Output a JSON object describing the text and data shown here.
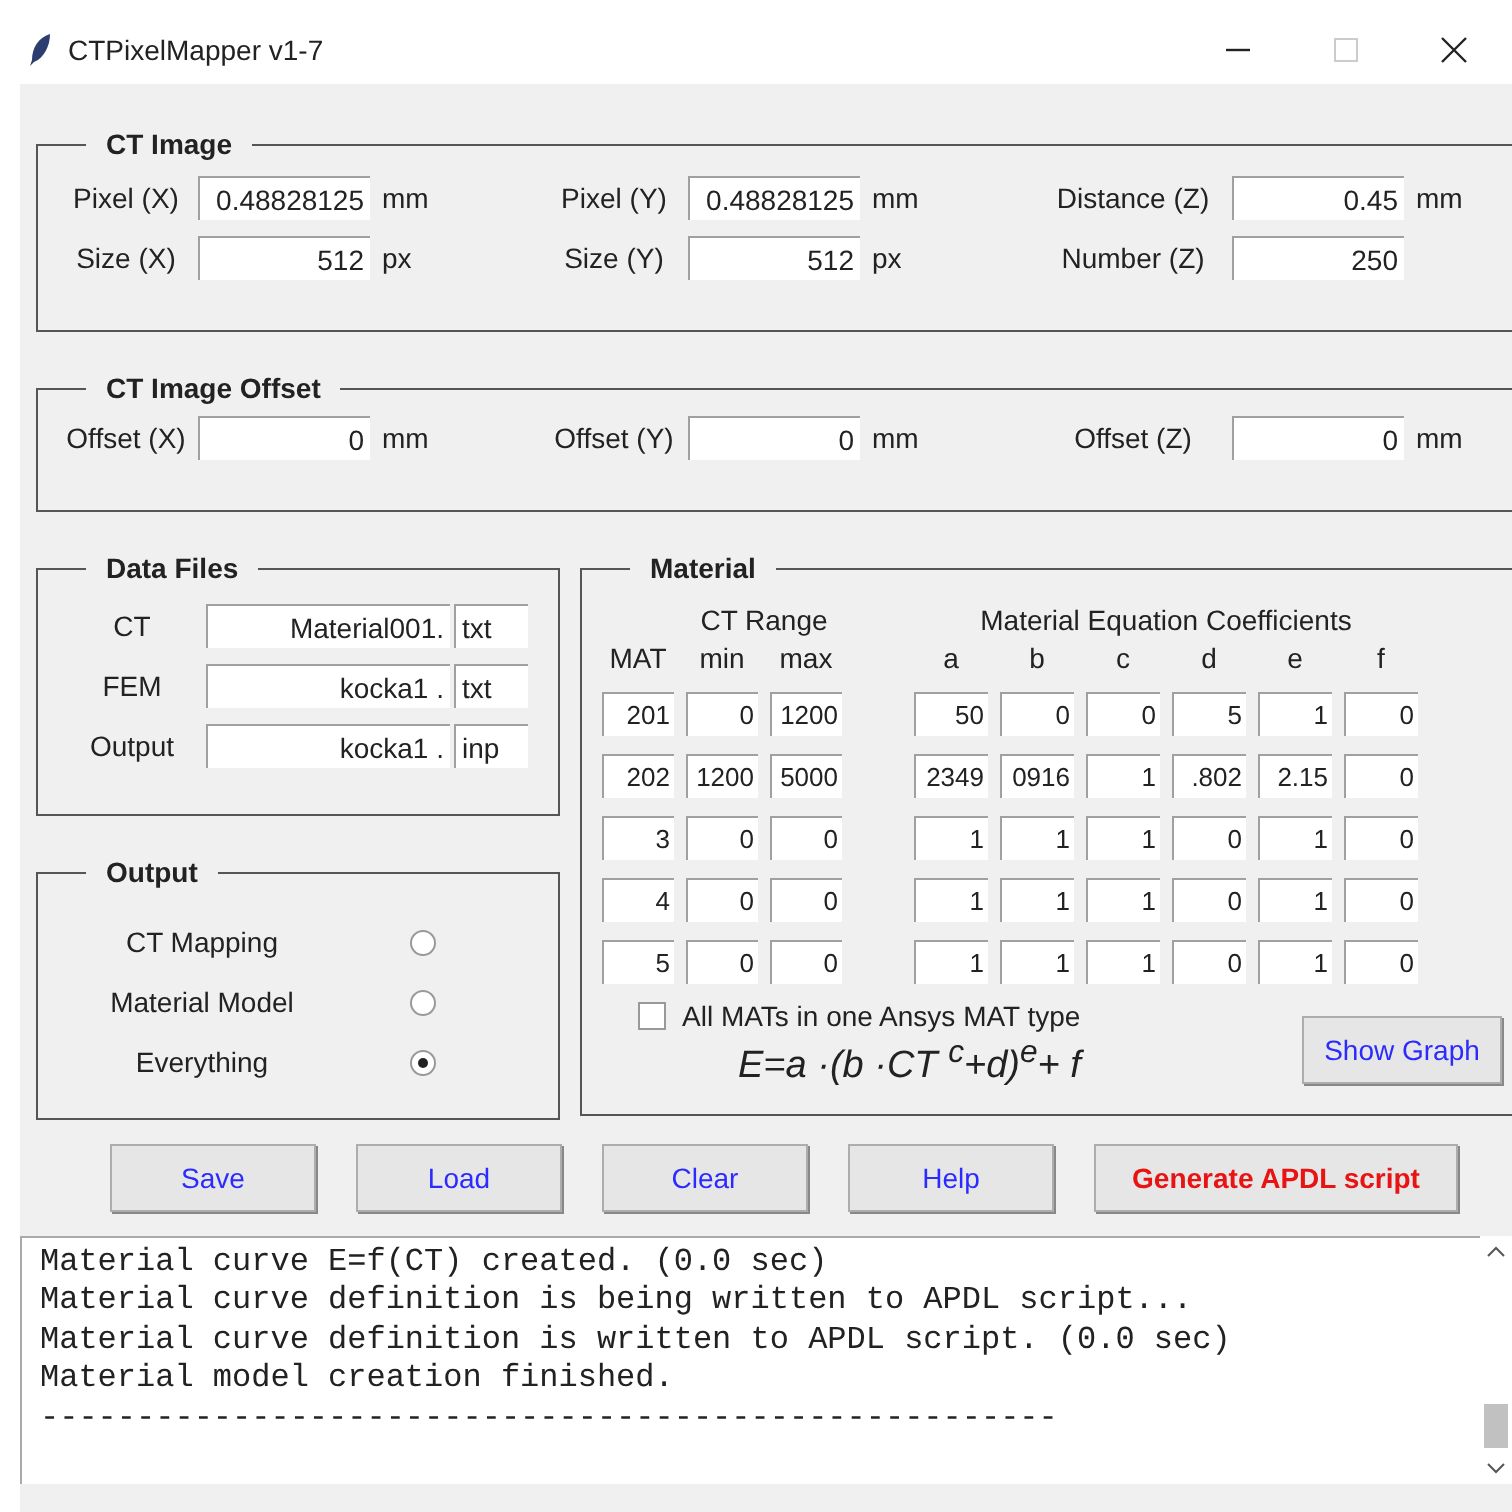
{
  "window": {
    "title": "CTPixelMapper v1-7"
  },
  "ct_image": {
    "title": "CT Image",
    "fields": [
      {
        "label": "Pixel (X)",
        "value": "0.48828125",
        "unit": "mm"
      },
      {
        "label": "Pixel (Y)",
        "value": "0.48828125",
        "unit": "mm"
      },
      {
        "label": "Distance (Z)",
        "value": "0.45",
        "unit": "mm"
      },
      {
        "label": "Size (X)",
        "value": "512",
        "unit": "px"
      },
      {
        "label": "Size (Y)",
        "value": "512",
        "unit": "px"
      },
      {
        "label": "Number (Z)",
        "value": "250"
      }
    ]
  },
  "ct_image_offset": {
    "title": "CT Image Offset",
    "fields": [
      {
        "label": "Offset (X)",
        "value": "0",
        "unit": "mm"
      },
      {
        "label": "Offset (Y)",
        "value": "0",
        "unit": "mm"
      },
      {
        "label": "Offset (Z)",
        "value": "0",
        "unit": "mm"
      }
    ]
  },
  "data_files": {
    "title": "Data Files",
    "rows": [
      {
        "label": "CT",
        "name": "Material001.",
        "ext": "txt"
      },
      {
        "label": "FEM",
        "name": "kocka1 .",
        "ext": "txt"
      },
      {
        "label": "Output",
        "name": "kocka1 .",
        "ext": "inp"
      }
    ]
  },
  "output": {
    "title": "Output",
    "options": [
      {
        "label": "CT Mapping",
        "selected": false
      },
      {
        "label": "Material Model",
        "selected": false
      },
      {
        "label": "Everything",
        "selected": true
      }
    ]
  },
  "material": {
    "title": "Material",
    "range_heading": "CT Range",
    "coef_heading": "Material Equation Coefficients",
    "columns": [
      "MAT",
      "min",
      "max",
      "a",
      "b",
      "c",
      "d",
      "e",
      "f"
    ],
    "rows": [
      [
        "201",
        "0",
        "1200",
        "50",
        "0",
        "0",
        "5",
        "1",
        "0"
      ],
      [
        "202",
        "1200",
        "5000",
        "2349",
        "0916",
        "1",
        ".802",
        "2.15",
        "0"
      ],
      [
        "3",
        "0",
        "0",
        "1",
        "1",
        "1",
        "0",
        "1",
        "0"
      ],
      [
        "4",
        "0",
        "0",
        "1",
        "1",
        "1",
        "0",
        "1",
        "0"
      ],
      [
        "5",
        "0",
        "0",
        "1",
        "1",
        "1",
        "0",
        "1",
        "0"
      ]
    ],
    "checkbox": {
      "label": "All MATs in one Ansys MAT type",
      "checked": false
    },
    "formula": "E=a ·(b ·CT $^{c}$+d)$^{e}$+ f",
    "graph_button": "Show Graph"
  },
  "buttons": [
    {
      "label": "Save",
      "kind": "normal"
    },
    {
      "label": "Load",
      "kind": "normal"
    },
    {
      "label": "Clear",
      "kind": "normal"
    },
    {
      "label": "Help",
      "kind": "normal"
    },
    {
      "label": "Generate APDL script",
      "kind": "accent"
    }
  ],
  "log": {
    "lines": [
      "Material curve E=f(CT) created. (0.0 sec)",
      "Material curve definition is being written to APDL script...",
      "Material curve definition is written to APDL script. (0.0 sec)",
      "Material model creation finished.",
      "-----------------------------------------------------"
    ]
  }
}
